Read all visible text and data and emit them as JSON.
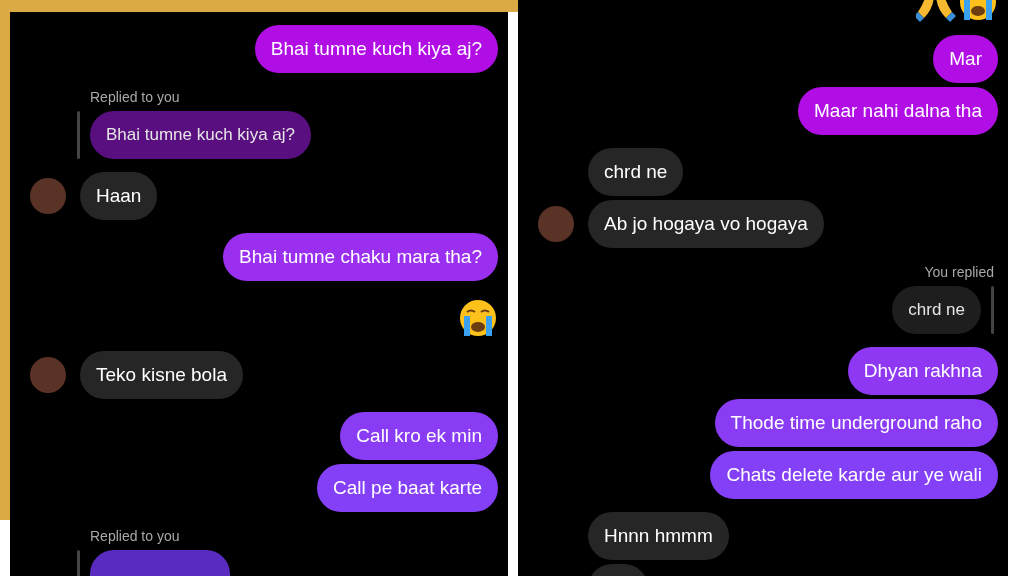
{
  "panels": [
    {
      "messages": [
        {
          "kind": "sent",
          "text": "Bhai tumne kuch kiya aj?",
          "color": "#b10ee6"
        },
        {
          "kind": "reply",
          "label": "Replied to you",
          "quote": "Bhai tumne kuch kiya aj?"
        },
        {
          "kind": "received",
          "text": "Haan",
          "avatar": true
        },
        {
          "kind": "sent",
          "text": "Bhai tumne chaku mara tha?",
          "color": "#9a2ff0"
        },
        {
          "kind": "emoji"
        },
        {
          "kind": "received",
          "text": "Teko kisne bola",
          "avatar": true
        },
        {
          "kind": "sent",
          "text": "Call kro ek min",
          "color": "#8a3cf5"
        },
        {
          "kind": "sent",
          "text": "Call pe baat karte",
          "color": "#8440f6"
        },
        {
          "kind": "reply",
          "label": "Replied to you"
        }
      ]
    },
    {
      "messages": [
        {
          "kind": "reaction"
        },
        {
          "kind": "sent",
          "text": "Mar",
          "color": "#b10ee6"
        },
        {
          "kind": "sent",
          "text": "Maar nahi dalna tha",
          "color": "#b10ee6"
        },
        {
          "kind": "received",
          "text": "chrd ne",
          "avatar": false
        },
        {
          "kind": "received",
          "text": "Ab jo hogaya vo hogaya",
          "avatar": true
        },
        {
          "kind": "selfreply",
          "label": "You replied",
          "quote": "chrd ne"
        },
        {
          "kind": "sent",
          "text": "Dhyan rakhna",
          "color": "#8f38f4"
        },
        {
          "kind": "sent",
          "text": "Thode time underground raho",
          "color": "#8a3cf5"
        },
        {
          "kind": "sent",
          "text": "Chats delete karde aur ye wali",
          "color": "#8440f6"
        },
        {
          "kind": "received",
          "text": "Hnnn hmmm",
          "avatar": false
        },
        {
          "kind": "received",
          "avatar": false
        }
      ]
    }
  ]
}
